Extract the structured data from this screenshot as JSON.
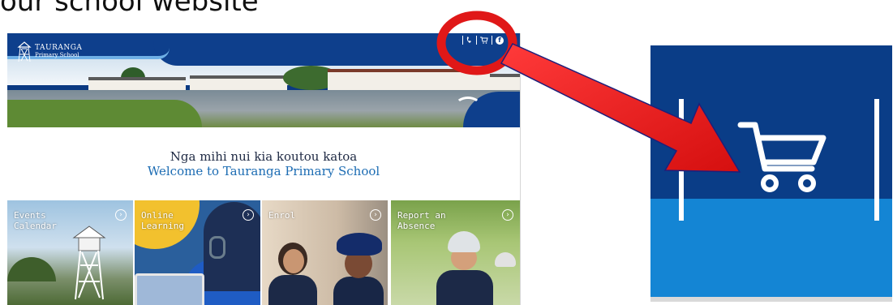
{
  "slide": {
    "title": "our school website"
  },
  "site": {
    "logo": {
      "line1": "TAURANGA",
      "line2": "Primary School"
    },
    "header_icons": [
      "phone-icon",
      "cart-icon",
      "facebook-icon"
    ],
    "facebook_letter": "f",
    "welcome": {
      "line1": "Nga mihi nui  kia koutou katoa",
      "line2": "Welcome to Tauranga  Primary School"
    },
    "tiles": [
      {
        "label": "Events\nCalendar"
      },
      {
        "label": "Online\nLearning"
      },
      {
        "label": "Enrol"
      },
      {
        "label": "Report an\nAbsence"
      }
    ],
    "colors": {
      "navy": "#0b3a82",
      "welcome_blue": "#1c6cb3",
      "highlight_red": "#e01818",
      "zoom_light_blue": "#1485d4"
    }
  },
  "zoom": {
    "icon": "shopping-cart-icon"
  }
}
